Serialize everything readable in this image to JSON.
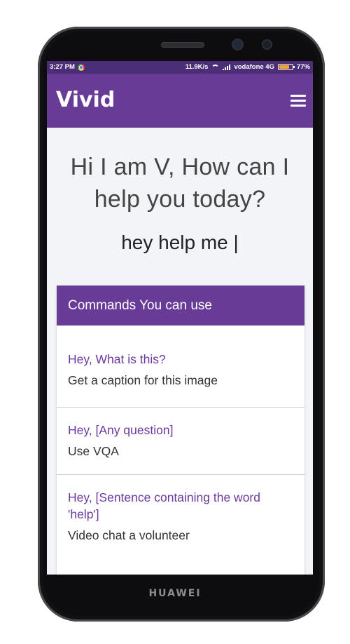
{
  "status": {
    "time": "3:27 PM",
    "speed": "11.9K/s",
    "carrier": "vodafone 4G",
    "battery": "77%",
    "battery_level": 0.77
  },
  "appbar": {
    "title": "Vivid",
    "menu_icon": "hamburger-menu-icon",
    "color": "#683b96"
  },
  "main": {
    "greeting": "Hi I am V, How can I help you today?",
    "typed_text": "hey help me |"
  },
  "commands": {
    "header": "Commands You can use",
    "items": [
      {
        "title": "Hey, What is this?",
        "desc": "Get a caption for this image"
      },
      {
        "title": "Hey, [Any question]",
        "desc": "Use VQA"
      },
      {
        "title": "Hey, [Sentence containing the word 'help']",
        "desc": "Video chat a volunteer"
      }
    ]
  },
  "device": {
    "brand": "HUAWEI"
  }
}
